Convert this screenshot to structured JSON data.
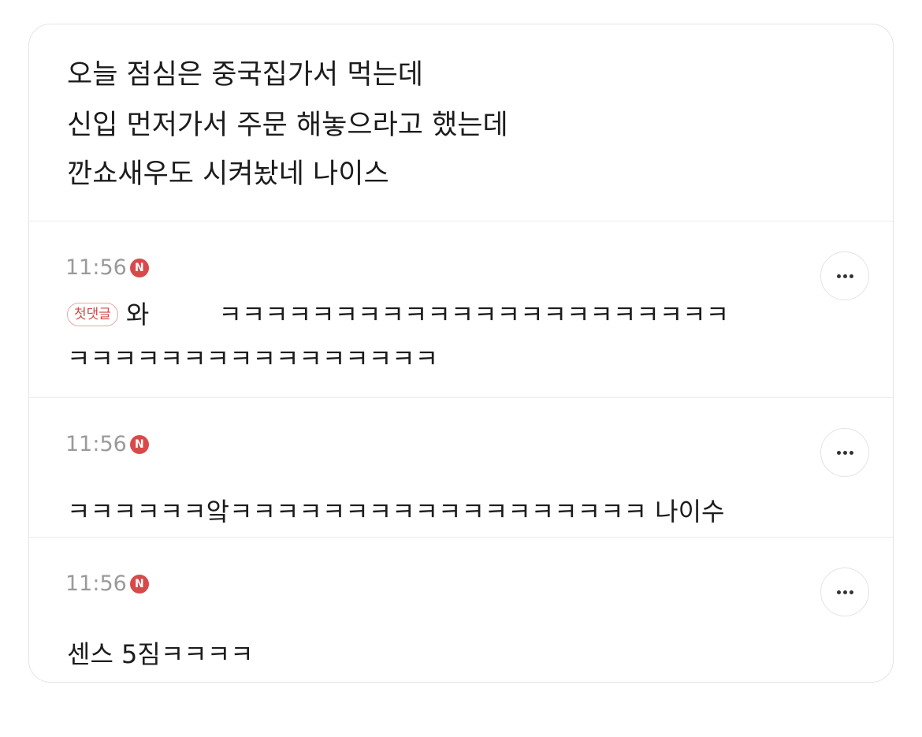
{
  "post": {
    "lines": [
      "오늘 점심은 중국집가서 먹는데",
      "신입 먼저가서 주문 해놓으라고 했는데",
      "깐쇼새우도 시켜놨네 나이스"
    ]
  },
  "comments": [
    {
      "time": "11:56",
      "new_badge": "N",
      "first_badge": "첫댓글",
      "text_prefix": "와",
      "text_line1": "ㅋㅋㅋㅋㅋㅋㅋㅋㅋㅋㅋㅋㅋㅋㅋㅋㅋㅋㅋㅋㅋㅋ",
      "text_line2": "ㅋㅋㅋㅋㅋㅋㅋㅋㅋㅋㅋㅋㅋㅋㅋㅋ"
    },
    {
      "time": "11:56",
      "new_badge": "N",
      "text": "ㅋㅋㅋㅋㅋㅋ앜ㅋㅋㅋㅋㅋㅋㅋㅋㅋㅋㅋㅋㅋㅋㅋㅋㅋㅋ 나이수"
    },
    {
      "time": "11:56",
      "new_badge": "N",
      "text": "센스 5짐ㅋㅋㅋㅋ"
    }
  ],
  "icons": {
    "more": "more-horizontal-icon",
    "new": "new-badge-icon"
  },
  "colors": {
    "badge_red": "#d84a4a",
    "time_gray": "#9a9a9a",
    "border": "#e4e4e4"
  }
}
